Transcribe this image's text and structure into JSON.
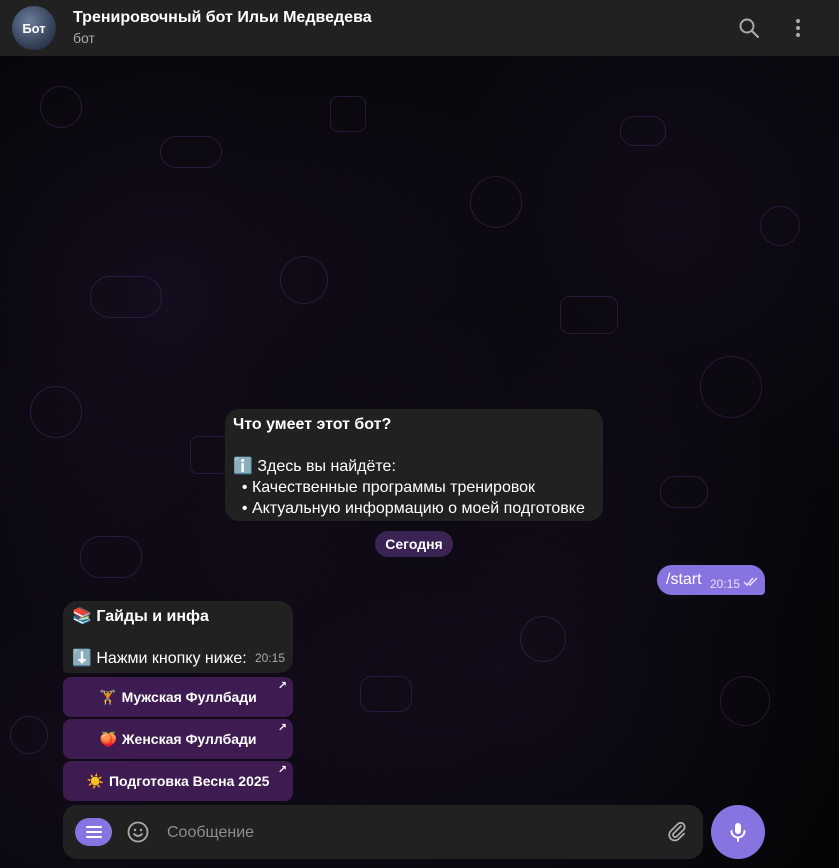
{
  "header": {
    "avatar_label": "Бот",
    "title": "Тренировочный бот Ильи Медведева",
    "subtitle": "бот",
    "search_icon": "search-icon",
    "more_icon": "more-vertical-icon"
  },
  "info_message": {
    "lines": [
      "Что умеет этот бот?",
      "",
      "ℹ️ Здесь вы найдёте:",
      "  • Качественные программы тренировок",
      "  • Актуальную информацию о моей подготовке"
    ]
  },
  "date_separator": "Сегодня",
  "outgoing_message": {
    "text": "/start",
    "time": "20:15"
  },
  "incoming_message": {
    "title": "📚 Гайды и инфа",
    "prompt": "⬇️ Нажми кнопку ниже:",
    "time": "20:15"
  },
  "keyboard_buttons": [
    {
      "emoji": "🏋️",
      "label": "Мужская Фуллбади"
    },
    {
      "emoji": "🍑",
      "label": "Женская Фуллбади"
    },
    {
      "emoji": "☀️",
      "label": "Подготовка Весна 2025"
    }
  ],
  "composer": {
    "placeholder": "Сообщение"
  },
  "colors": {
    "accent": "#8774e1",
    "header_bg": "#212121",
    "bubble_bg": "#212121"
  }
}
